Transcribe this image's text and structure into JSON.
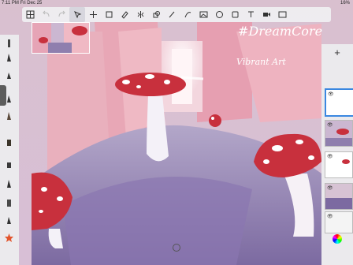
{
  "status": {
    "time": "7:11 PM",
    "date": "Fri Dec 25",
    "battery": "16%"
  },
  "toolbar": {
    "tools": [
      {
        "name": "gallery",
        "icon": "grid-icon"
      },
      {
        "name": "undo",
        "icon": "undo-icon"
      },
      {
        "name": "redo",
        "icon": "redo-icon"
      },
      {
        "name": "select",
        "icon": "selection-icon"
      },
      {
        "name": "move",
        "icon": "move-icon"
      },
      {
        "name": "crop",
        "icon": "crop-icon"
      },
      {
        "name": "eraser",
        "icon": "eraser-icon"
      },
      {
        "name": "symmetry",
        "icon": "symmetry-icon"
      },
      {
        "name": "shape",
        "icon": "shape-icon"
      },
      {
        "name": "pen",
        "icon": "pen-icon"
      },
      {
        "name": "curve",
        "icon": "curve-icon"
      },
      {
        "name": "image",
        "icon": "image-icon"
      },
      {
        "name": "fill",
        "icon": "fill-icon"
      },
      {
        "name": "sticker",
        "icon": "sticker-icon"
      },
      {
        "name": "text",
        "icon": "text-icon"
      },
      {
        "name": "media",
        "icon": "video-icon"
      },
      {
        "name": "fullscreen",
        "icon": "fullscreen-icon"
      }
    ]
  },
  "canvas_text": {
    "line1": "#DreamCore",
    "line2": "Vibrant Art"
  },
  "colors": {
    "sky_pink": "#e8a7b6",
    "floor_lavender": "#8f7fae",
    "mushroom_red": "#c8303d",
    "accent_blue": "#3a87e0"
  }
}
